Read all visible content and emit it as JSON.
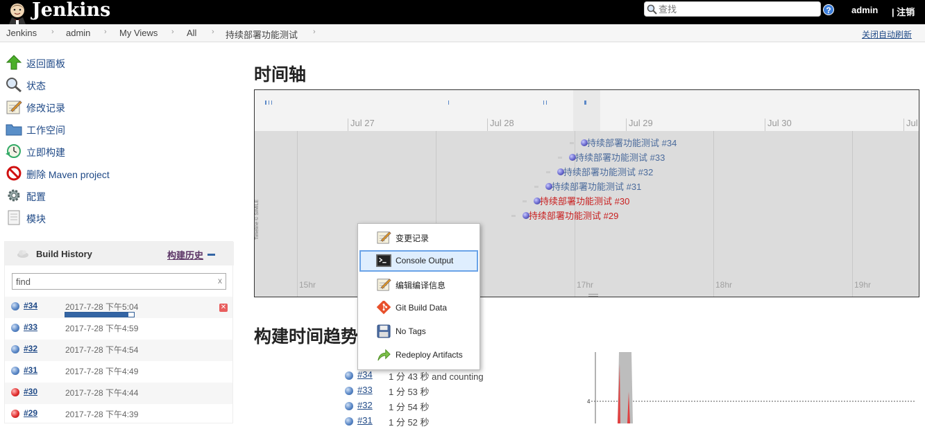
{
  "header": {
    "app_name": "Jenkins",
    "search_placeholder": "查找",
    "help_label": "?",
    "user": "admin",
    "logout": "| 注销"
  },
  "breadcrumbs": {
    "items": [
      "Jenkins",
      "admin",
      "My Views",
      "All",
      "持续部署功能测试"
    ],
    "auto_refresh": "关闭自动刷新"
  },
  "tasks": [
    {
      "label": "返回面板",
      "icon": "up-arrow-icon"
    },
    {
      "label": "状态",
      "icon": "magnifier-icon"
    },
    {
      "label": "修改记录",
      "icon": "notepad-icon"
    },
    {
      "label": "工作空间",
      "icon": "folder-icon"
    },
    {
      "label": "立即构建",
      "icon": "clock-build-icon"
    },
    {
      "label": "删除 Maven project",
      "icon": "no-entry-icon"
    },
    {
      "label": "配置",
      "icon": "gear-icon"
    },
    {
      "label": "模块",
      "icon": "document-icon"
    }
  ],
  "build_history": {
    "title": "Build History",
    "trend_link": "构建历史",
    "filter_value": "find",
    "clear": "x",
    "builds": [
      {
        "number": "#34",
        "date": "2017-7-28 下午5:04",
        "status": "blue",
        "progress": 0.92,
        "in_progress": true
      },
      {
        "number": "#33",
        "date": "2017-7-28 下午4:59",
        "status": "blue"
      },
      {
        "number": "#32",
        "date": "2017-7-28 下午4:54",
        "status": "blue"
      },
      {
        "number": "#31",
        "date": "2017-7-28 下午4:49",
        "status": "blue"
      },
      {
        "number": "#30",
        "date": "2017-7-28 下午4:44",
        "status": "red"
      },
      {
        "number": "#29",
        "date": "2017-7-28 下午4:39",
        "status": "red"
      }
    ]
  },
  "timeline": {
    "title": "时间轴",
    "date_labels": [
      "Jul 27",
      "Jul 28",
      "Jul 29",
      "Jul 30",
      "Jul"
    ],
    "hour_labels": [
      "15hr",
      "16hr",
      "17hr",
      "18hr",
      "19hr"
    ],
    "credit": "Timeline © SIMILE",
    "events": [
      {
        "label": "持续部署功能测试 #34",
        "color": "#4b6b9c"
      },
      {
        "label": "持续部署功能测试 #33",
        "color": "#4b6b9c"
      },
      {
        "label": "持续部署功能测试 #32",
        "color": "#4b6b9c"
      },
      {
        "label": "持续部署功能测试 #31",
        "color": "#4b6b9c"
      },
      {
        "label": "持续部署功能测试 #30",
        "color": "#c82020"
      },
      {
        "label": "持续部署功能测试 #29",
        "color": "#c82020"
      }
    ]
  },
  "popup_menu": {
    "items": [
      {
        "label": "变更记录",
        "icon": "notepad-icon",
        "selected": false
      },
      {
        "label": "Console Output",
        "icon": "terminal-icon",
        "selected": true
      },
      {
        "label": "编辑编译信息",
        "icon": "notepad-icon",
        "selected": false
      },
      {
        "label": "Git Build Data",
        "icon": "git-icon",
        "selected": false
      },
      {
        "label": "No Tags",
        "icon": "floppy-disk-icon",
        "selected": false
      },
      {
        "label": "Redeploy Artifacts",
        "icon": "redeploy-arrow-icon",
        "selected": false
      }
    ]
  },
  "build_trend": {
    "title": "构建时间趋势",
    "rows": [
      {
        "number": "#34",
        "duration": "1 分 43 秒 and counting",
        "status": "blue"
      },
      {
        "number": "#33",
        "duration": "1 分 53 秒",
        "status": "blue"
      },
      {
        "number": "#32",
        "duration": "1 分 54 秒",
        "status": "blue"
      },
      {
        "number": "#31",
        "duration": "1 分 52 秒",
        "status": "blue"
      }
    ],
    "axis_label": "4"
  },
  "colors": {
    "header_bg": "#000000",
    "link": "#204a87",
    "success": "#3465a4",
    "failure": "#e23030"
  }
}
